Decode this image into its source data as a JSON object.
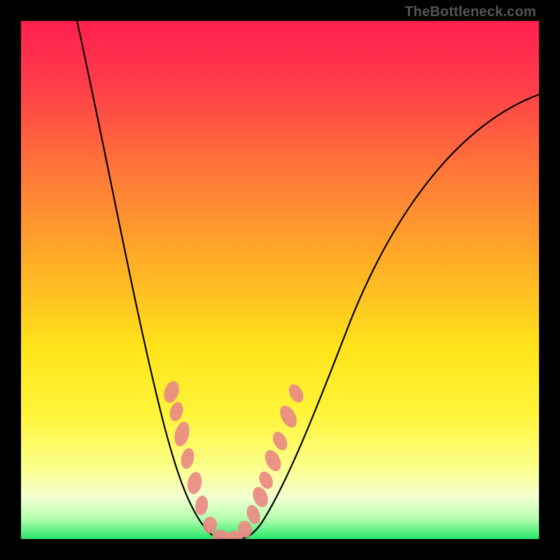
{
  "watermark": "TheBottleneck.com",
  "chart_data": {
    "type": "line",
    "title": "",
    "xlabel": "",
    "ylabel": "",
    "xlim": [
      0,
      100
    ],
    "ylim": [
      0,
      100
    ],
    "background_gradient": {
      "orientation": "vertical",
      "stops": [
        {
          "pos": 0.0,
          "color": "#ff1f4f"
        },
        {
          "pos": 0.3,
          "color": "#ff7a38"
        },
        {
          "pos": 0.63,
          "color": "#ffe31a"
        },
        {
          "pos": 0.92,
          "color": "#f1ffd0"
        },
        {
          "pos": 1.0,
          "color": "#28e86a"
        }
      ]
    },
    "series": [
      {
        "name": "bottleneck-curve",
        "style": "black-thin-line",
        "x": [
          11,
          16,
          22,
          27,
          32,
          36,
          40,
          42,
          47,
          51,
          58,
          64,
          72,
          84,
          100
        ],
        "y": [
          100,
          76,
          46,
          24,
          11,
          4,
          1,
          0,
          3,
          10,
          25,
          42,
          60,
          78,
          86
        ],
        "note": "x is horizontal position as % of plot width left→right; y is % of plot height measured from bottom (0) to top (100). Curve descends steeply from top-left to a minimum near x≈40–42 then rises with decreasing slope toward the right edge."
      },
      {
        "name": "marker-dots",
        "style": "salmon-ellipses-on-curve",
        "x": [
          29,
          30,
          31,
          32,
          34,
          35,
          37,
          39,
          41,
          43,
          45,
          46,
          47,
          49,
          50,
          52,
          53
        ],
        "y": [
          28,
          25,
          20,
          16,
          11,
          7,
          3,
          1,
          0,
          2,
          5,
          8,
          11,
          15,
          19,
          24,
          28
        ],
        "note": "Approximate centers of the pink marker blobs clustered around the curve's lower section and minimum."
      }
    ],
    "legend": null,
    "grid": false
  }
}
